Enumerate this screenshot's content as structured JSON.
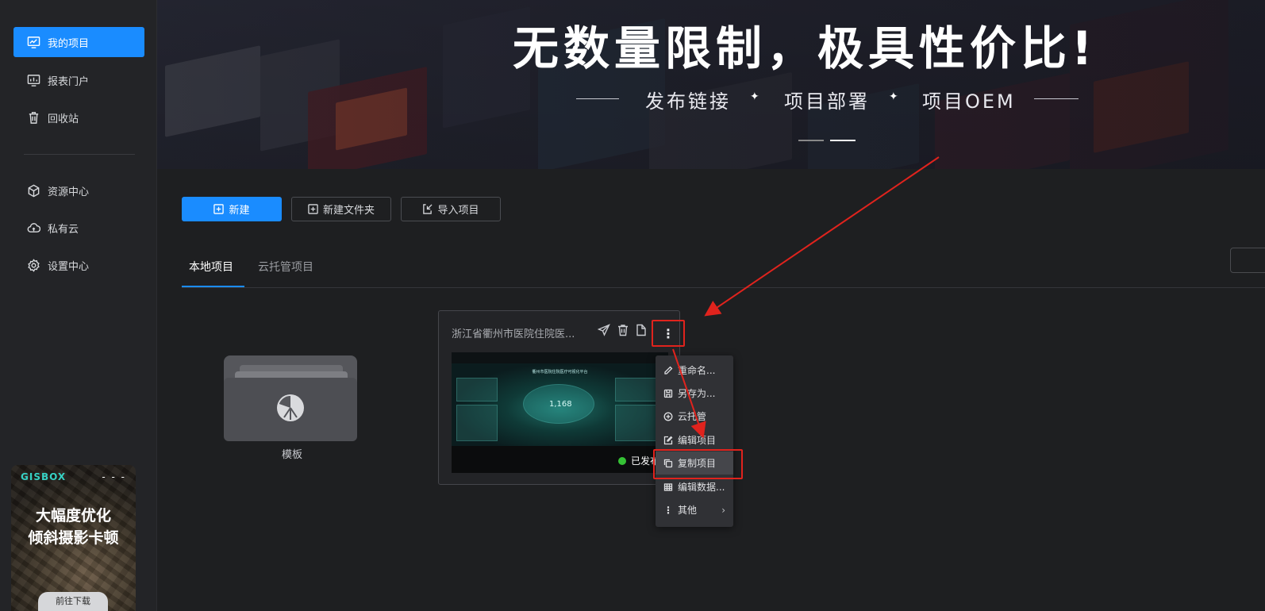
{
  "sidebar": {
    "items": [
      {
        "label": "我的项目",
        "icon": "chart-monitor-icon",
        "active": true
      },
      {
        "label": "报表门户",
        "icon": "report-monitor-icon"
      },
      {
        "label": "回收站",
        "icon": "trash-icon"
      },
      {
        "label": "资源中心",
        "icon": "hexagon-box-icon"
      },
      {
        "label": "私有云",
        "icon": "cloud-icon"
      },
      {
        "label": "设置中心",
        "icon": "gear-icon"
      }
    ],
    "promo": {
      "brand": "GISBOX",
      "dash": "- - -",
      "line1": "大幅度优化",
      "line2": "倾斜摄影卡顿",
      "button": "前往下载"
    }
  },
  "banner": {
    "title": "无数量限制，极具性价比!",
    "features": [
      "发布链接",
      "项目部署",
      "项目OEM"
    ]
  },
  "toolbar": {
    "new_label": "新建",
    "new_folder_label": "新建文件夹",
    "import_label": "导入项目"
  },
  "tabs": [
    {
      "label": "本地项目",
      "active": true
    },
    {
      "label": "云托管项目"
    }
  ],
  "template_folder": {
    "label": "模板"
  },
  "project_card": {
    "title": "浙江省衢州市医院住院医...",
    "thumb_title": "衢州市医院住院医疗可视化平台",
    "thumb_value": "1,168",
    "status": "已发布"
  },
  "context_menu": {
    "items": [
      {
        "label": "重命名...",
        "icon": "pencil-icon"
      },
      {
        "label": "另存为...",
        "icon": "save-icon"
      },
      {
        "label": "云托管",
        "icon": "plus-circle-icon"
      },
      {
        "label": "编辑项目",
        "icon": "edit-icon"
      },
      {
        "label": "复制项目",
        "icon": "copy-icon",
        "highlighted": true
      },
      {
        "label": "编辑数据...",
        "icon": "table-icon"
      },
      {
        "label": "其他",
        "icon": "more-vertical-icon",
        "submenu": true
      }
    ]
  },
  "colors": {
    "accent": "#1a8cff",
    "annotation": "#e0231d",
    "background": "#1e1f21",
    "published": "#35c235"
  }
}
